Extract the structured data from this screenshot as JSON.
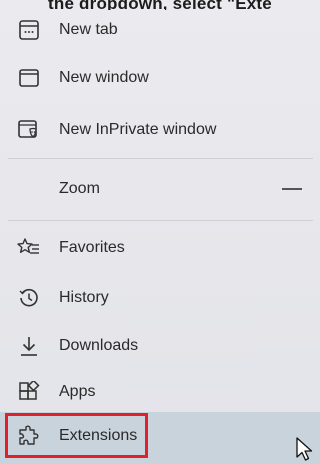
{
  "caption": {
    "text": "the dropdown, select \"Exte"
  },
  "menu": {
    "items": [
      {
        "id": "new-tab",
        "label": "New tab",
        "icon": "new-tab-icon"
      },
      {
        "id": "new-window",
        "label": "New window",
        "icon": "window-icon"
      },
      {
        "id": "new-inprivate-window",
        "label": "New InPrivate window",
        "icon": "inprivate-icon"
      },
      {
        "id": "zoom",
        "label": "Zoom",
        "control": "—"
      },
      {
        "id": "favorites",
        "label": "Favorites",
        "icon": "favorites-icon"
      },
      {
        "id": "history",
        "label": "History",
        "icon": "history-icon"
      },
      {
        "id": "downloads",
        "label": "Downloads",
        "icon": "download-icon"
      },
      {
        "id": "apps",
        "label": "Apps",
        "icon": "apps-icon"
      },
      {
        "id": "extensions",
        "label": "Extensions",
        "icon": "extensions-icon",
        "highlighted": true
      }
    ]
  },
  "colors": {
    "highlight_row": "#c9d3dc",
    "annotation_box": "#e0202a"
  }
}
